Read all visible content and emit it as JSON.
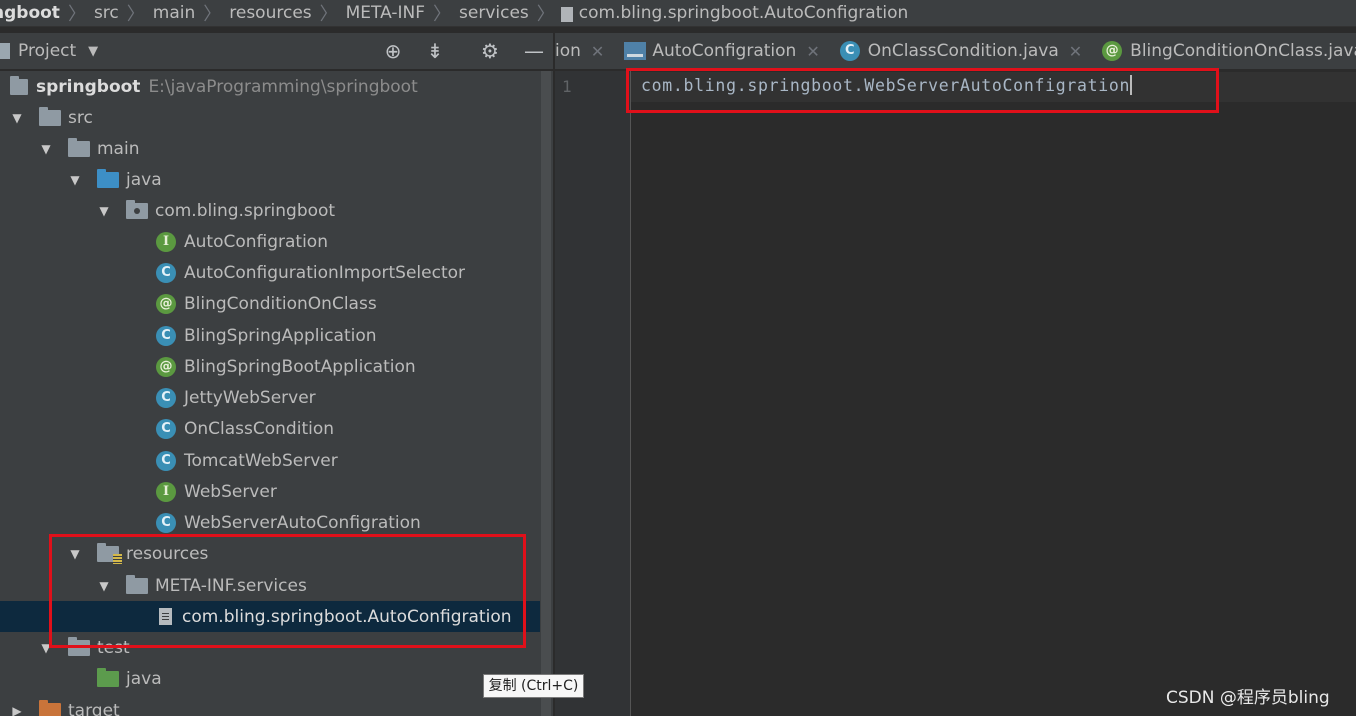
{
  "breadcrumb": {
    "items": [
      "ngboot",
      "src",
      "main",
      "resources",
      "META-INF",
      "services"
    ],
    "file": "com.bling.springboot.AutoConfigration"
  },
  "project_panel": {
    "title": "Project",
    "toolbar_icons": [
      "locate-icon",
      "collapse-icon",
      "gear-icon",
      "minimize-icon"
    ]
  },
  "tree": {
    "root_name": "springboot",
    "root_path": "E:\\javaProgramming\\springboot",
    "src": "src",
    "main": "main",
    "java": "java",
    "package": "com.bling.springboot",
    "classes": [
      {
        "name": "AutoConfigration",
        "kind": "I"
      },
      {
        "name": "AutoConfigurationImportSelector",
        "kind": "C"
      },
      {
        "name": "BlingConditionOnClass",
        "kind": "@"
      },
      {
        "name": "BlingSpringApplication",
        "kind": "C"
      },
      {
        "name": "BlingSpringBootApplication",
        "kind": "@"
      },
      {
        "name": "JettyWebServer",
        "kind": "C"
      },
      {
        "name": "OnClassCondition",
        "kind": "C"
      },
      {
        "name": "TomcatWebServer",
        "kind": "C"
      },
      {
        "name": "WebServer",
        "kind": "I"
      },
      {
        "name": "WebServerAutoConfigration",
        "kind": "C"
      }
    ],
    "resources": "resources",
    "meta_inf": "META-INF.services",
    "service_file": "com.bling.springboot.AutoConfigration",
    "test": "test",
    "test_java": "java",
    "target": "target"
  },
  "tabs": [
    {
      "label": "ion",
      "icon": ""
    },
    {
      "label": "AutoConfigration",
      "icon": "config-file-icon"
    },
    {
      "label": "OnClassCondition.java",
      "icon": "class-icon"
    },
    {
      "label": "BlingConditionOnClass.java",
      "icon": "annotation-icon"
    }
  ],
  "editor": {
    "line_number": "1",
    "code": "com.bling.springboot.WebServerAutoConfigration"
  },
  "tooltip": "复制 (Ctrl+C)",
  "watermark": "CSDN @程序员bling",
  "colors": {
    "highlight": "#e0101a",
    "selection": "#0d293e",
    "background": "#2b2b2b"
  }
}
